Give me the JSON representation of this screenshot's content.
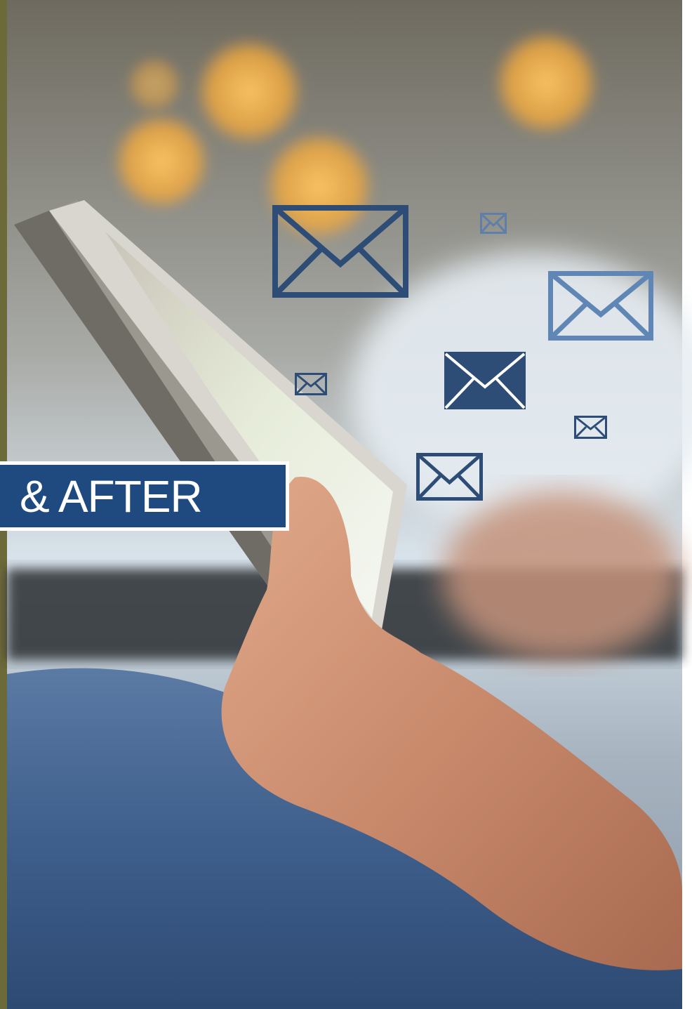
{
  "banner": {
    "text": "& AFTER"
  },
  "colors": {
    "banner_bg": "#1f4a80",
    "banner_border": "#ffffff",
    "envelope_dark": "#2e4d76",
    "envelope_light": "#5f86b5",
    "denim": "#3f5f8c",
    "skin": "#c98a6c",
    "bokeh": "#f3a93c"
  },
  "icons": [
    "envelope-outline-icon",
    "envelope-outline-small-icon",
    "envelope-outline-light-icon",
    "envelope-filled-icon",
    "envelope-outline-tiny-icon"
  ]
}
